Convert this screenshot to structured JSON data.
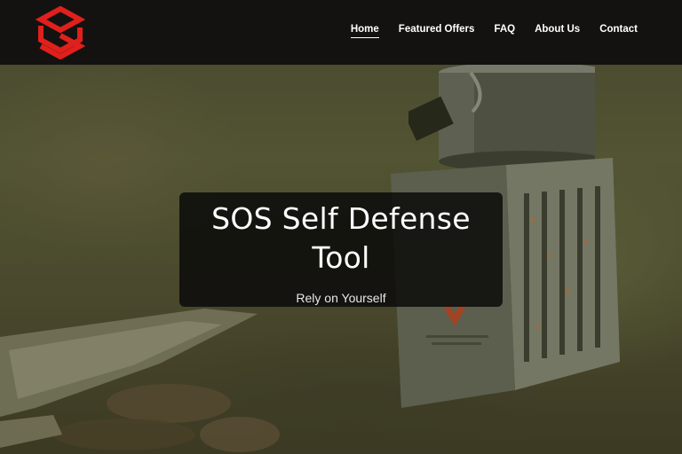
{
  "header": {
    "logo": {
      "icon": "sos-logo-icon",
      "color": "#e0201c"
    },
    "nav": {
      "items": [
        {
          "label": "Home",
          "active": true
        },
        {
          "label": "Featured Offers",
          "active": false
        },
        {
          "label": "FAQ",
          "active": false
        },
        {
          "label": "About Us",
          "active": false
        },
        {
          "label": "Contact",
          "active": false
        }
      ]
    }
  },
  "hero": {
    "title": "SOS Self Defense Tool",
    "subtitle": "Rely on Yourself",
    "background_image": "camping-stove-with-pot-on-forest-ground"
  },
  "colors": {
    "header_bg": "#141210",
    "nav_text": "#ffffff",
    "card_bg": "#0a0a0a",
    "logo_red": "#e0201c"
  }
}
